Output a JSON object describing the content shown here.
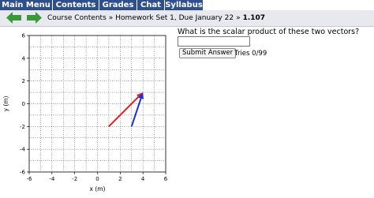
{
  "menu": {
    "items": [
      {
        "label": "Main Menu"
      },
      {
        "label": "Contents"
      },
      {
        "label": "Grades"
      },
      {
        "label": "Chat"
      },
      {
        "label": "Syllabus"
      }
    ]
  },
  "nav": {
    "back_icon": "green-left-arrow",
    "forward_icon": "green-right-arrow",
    "breadcrumb": [
      "Course Contents",
      "Homework Set 1, Due January 22",
      "1.107"
    ],
    "separator": "»"
  },
  "problem": {
    "question": "What is the scalar product of these two vectors?",
    "answer_value": "",
    "submit_label": "Submit Answer",
    "tries": "Tries 0/99"
  },
  "colors": {
    "menu_bg": "#2f4f8c",
    "vector_red": "#e02020",
    "vector_blue": "#1a2fd0",
    "nav_arrow": "#3a9a3a"
  },
  "chart_data": {
    "type": "vector-plot",
    "xlabel": "x (m)",
    "ylabel": "y (m)",
    "xlim": [
      -6,
      6
    ],
    "ylim": [
      -6,
      6
    ],
    "xticks": [
      "-6",
      "-4",
      "-2",
      "0",
      "2",
      "4",
      "6"
    ],
    "yticks": [
      "6",
      "4",
      "2",
      "0",
      "-2",
      "-4",
      "-6"
    ],
    "grid": true,
    "vectors": [
      {
        "color": "red",
        "from": [
          1,
          -2
        ],
        "to": [
          4,
          1
        ]
      },
      {
        "color": "blue",
        "from": [
          3,
          -2
        ],
        "to": [
          4,
          1
        ]
      }
    ]
  }
}
